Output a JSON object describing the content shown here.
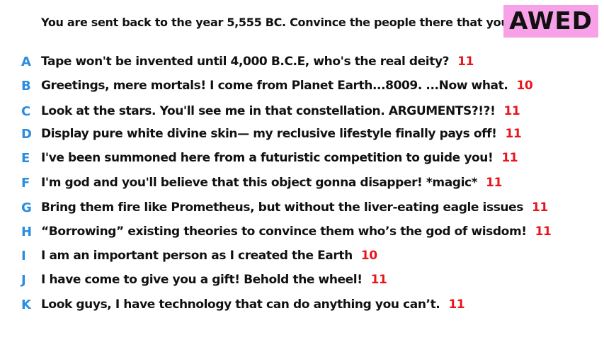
{
  "prompt": "You are sent back to the year 5,555 BC. Convince the people there that you're a god.",
  "badge": {
    "label": "AWED",
    "color": "#f7a1e8"
  },
  "colors": {
    "letter": "#2a8de0",
    "score": "#e8151b"
  },
  "answers": [
    {
      "letter": "A",
      "text": "Tape won't be invented until 4,000 B.C.E, who's the real deity?",
      "score": "11"
    },
    {
      "letter": "B",
      "text": "Greetings, mere mortals! I come from Planet Earth...8009. ...Now what.",
      "score": "10"
    },
    {
      "letter": "C",
      "text": "Look at the stars. You'll see me in that constellation. ARGUMENTS?!?!",
      "score": "11"
    },
    {
      "letter": "D",
      "text": "Display pure white divine skin— my reclusive lifestyle finally pays off!",
      "score": "11"
    },
    {
      "letter": "E",
      "text": "I've been summoned here from a futuristic competition to guide you!",
      "score": "11"
    },
    {
      "letter": "F",
      "text": "I'm god and you'll believe that this object gonna disapper! *magic*",
      "score": "11"
    },
    {
      "letter": "G",
      "text": "Bring them fire like Prometheus, but without the liver-eating eagle issues",
      "score": "11"
    },
    {
      "letter": "H",
      "text": "“Borrowing” existing theories to convince them who’s the god of wisdom!",
      "score": "11"
    },
    {
      "letter": "I",
      "text": "I am an important person as I created the Earth",
      "score": "10"
    },
    {
      "letter": "J",
      "text": "I have come to give you a gift! Behold the wheel!",
      "score": "11"
    },
    {
      "letter": "K",
      "text": "Look guys, I have technology that can do anything you can’t.",
      "score": "11"
    }
  ]
}
